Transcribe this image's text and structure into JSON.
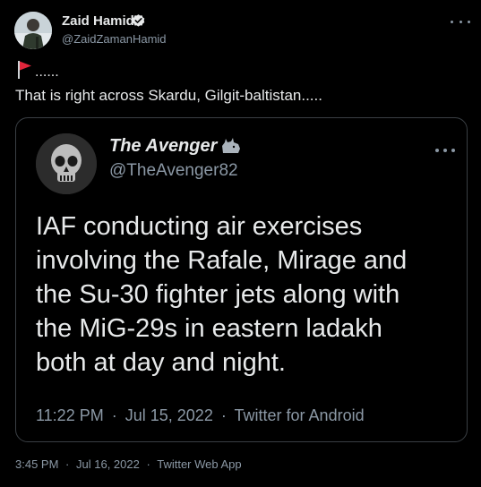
{
  "author": {
    "name": "Zaid Hamid",
    "handle": "@ZaidZamanHamid",
    "verified": true
  },
  "icons": {
    "author_avatar": "profile-photo",
    "verified": "verified-badge-icon",
    "more": "more-horizontal-icon",
    "flag": "triangular-flag-icon",
    "quoted_avatar": "skull-avatar",
    "quoted_badge": "rhino-icon"
  },
  "tweet": {
    "flag_dots": "......",
    "text": "That is right across Skardu, Gilgit-baltistan.....",
    "time": "3:45 PM",
    "date": "Jul 16, 2022",
    "source": "Twitter Web App",
    "separator": "·"
  },
  "quoted": {
    "name": "The Avenger",
    "handle": "@TheAvenger82",
    "text_lines": [
      "IAF conducting air exercises",
      "involving the Rafale, Mirage and",
      "the Su-30 fighter jets along with",
      "the MiG-29s in eastern ladakh",
      "both at day and night."
    ],
    "time": "11:22 PM",
    "date": "Jul 15, 2022",
    "source": "Twitter for Android",
    "separator": "·"
  },
  "colors": {
    "background": "#000000",
    "text_primary": "#e7e9ea",
    "text_secondary": "#8b98a5",
    "card_border": "#3a3f44",
    "flag_red": "#e0263b"
  }
}
